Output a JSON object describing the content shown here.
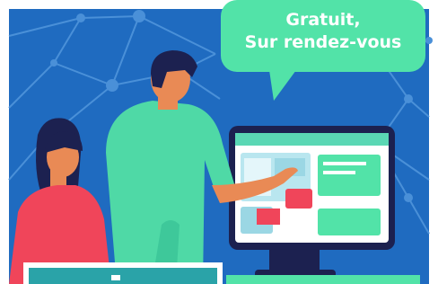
{
  "illustration": {
    "bubble_line1": "Gratuit,",
    "bubble_line2": "Sur rendez-vous"
  },
  "colors": {
    "background": "#1f6bc0",
    "network": "#4a90d8",
    "bubble": "#52e3a8",
    "man_shirt": "#4fd9a6",
    "woman_shirt": "#f0455a",
    "skin": "#e98a55",
    "hair": "#1c2150",
    "monitor_frame": "#1c2150",
    "card": "#2aa3a8"
  }
}
